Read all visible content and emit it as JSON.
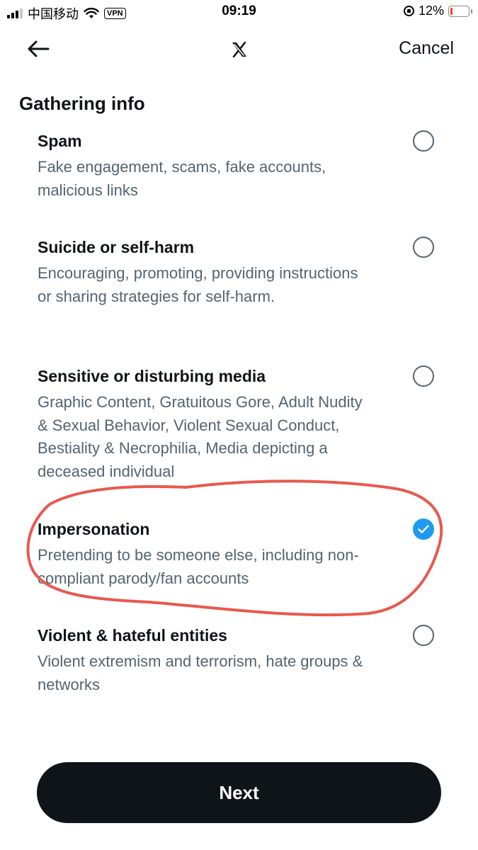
{
  "status_bar": {
    "carrier": "中国移动",
    "vpn": "VPN",
    "time": "09:19",
    "battery": "12%",
    "battery_level": 0.12
  },
  "header": {
    "logo": "X",
    "cancel_label": "Cancel"
  },
  "section_title": "Gathering info",
  "options": [
    {
      "title": "Spam",
      "description": "Fake engagement, scams, fake accounts, malicious links",
      "selected": false
    },
    {
      "title": "Suicide or self-harm",
      "description": "Encouraging, promoting, providing instructions or sharing strategies for self-harm.",
      "selected": false
    },
    {
      "title": "Sensitive or disturbing media",
      "description": "Graphic Content, Gratuitous Gore, Adult Nudity & Sexual Behavior, Violent Sexual Conduct, Bestiality & Necrophilia, Media depicting a deceased individual",
      "selected": false
    },
    {
      "title": "Impersonation",
      "description": "Pretending to be someone else, including non-compliant parody/fan accounts",
      "selected": true
    },
    {
      "title": "Violent & hateful entities",
      "description": "Violent extremism and terrorism, hate groups & networks",
      "selected": false
    }
  ],
  "next_label": "Next",
  "colors": {
    "accent": "#1d9bf0",
    "text_primary": "#0f1419",
    "text_secondary": "#536471",
    "annotation": "#e8594f"
  }
}
